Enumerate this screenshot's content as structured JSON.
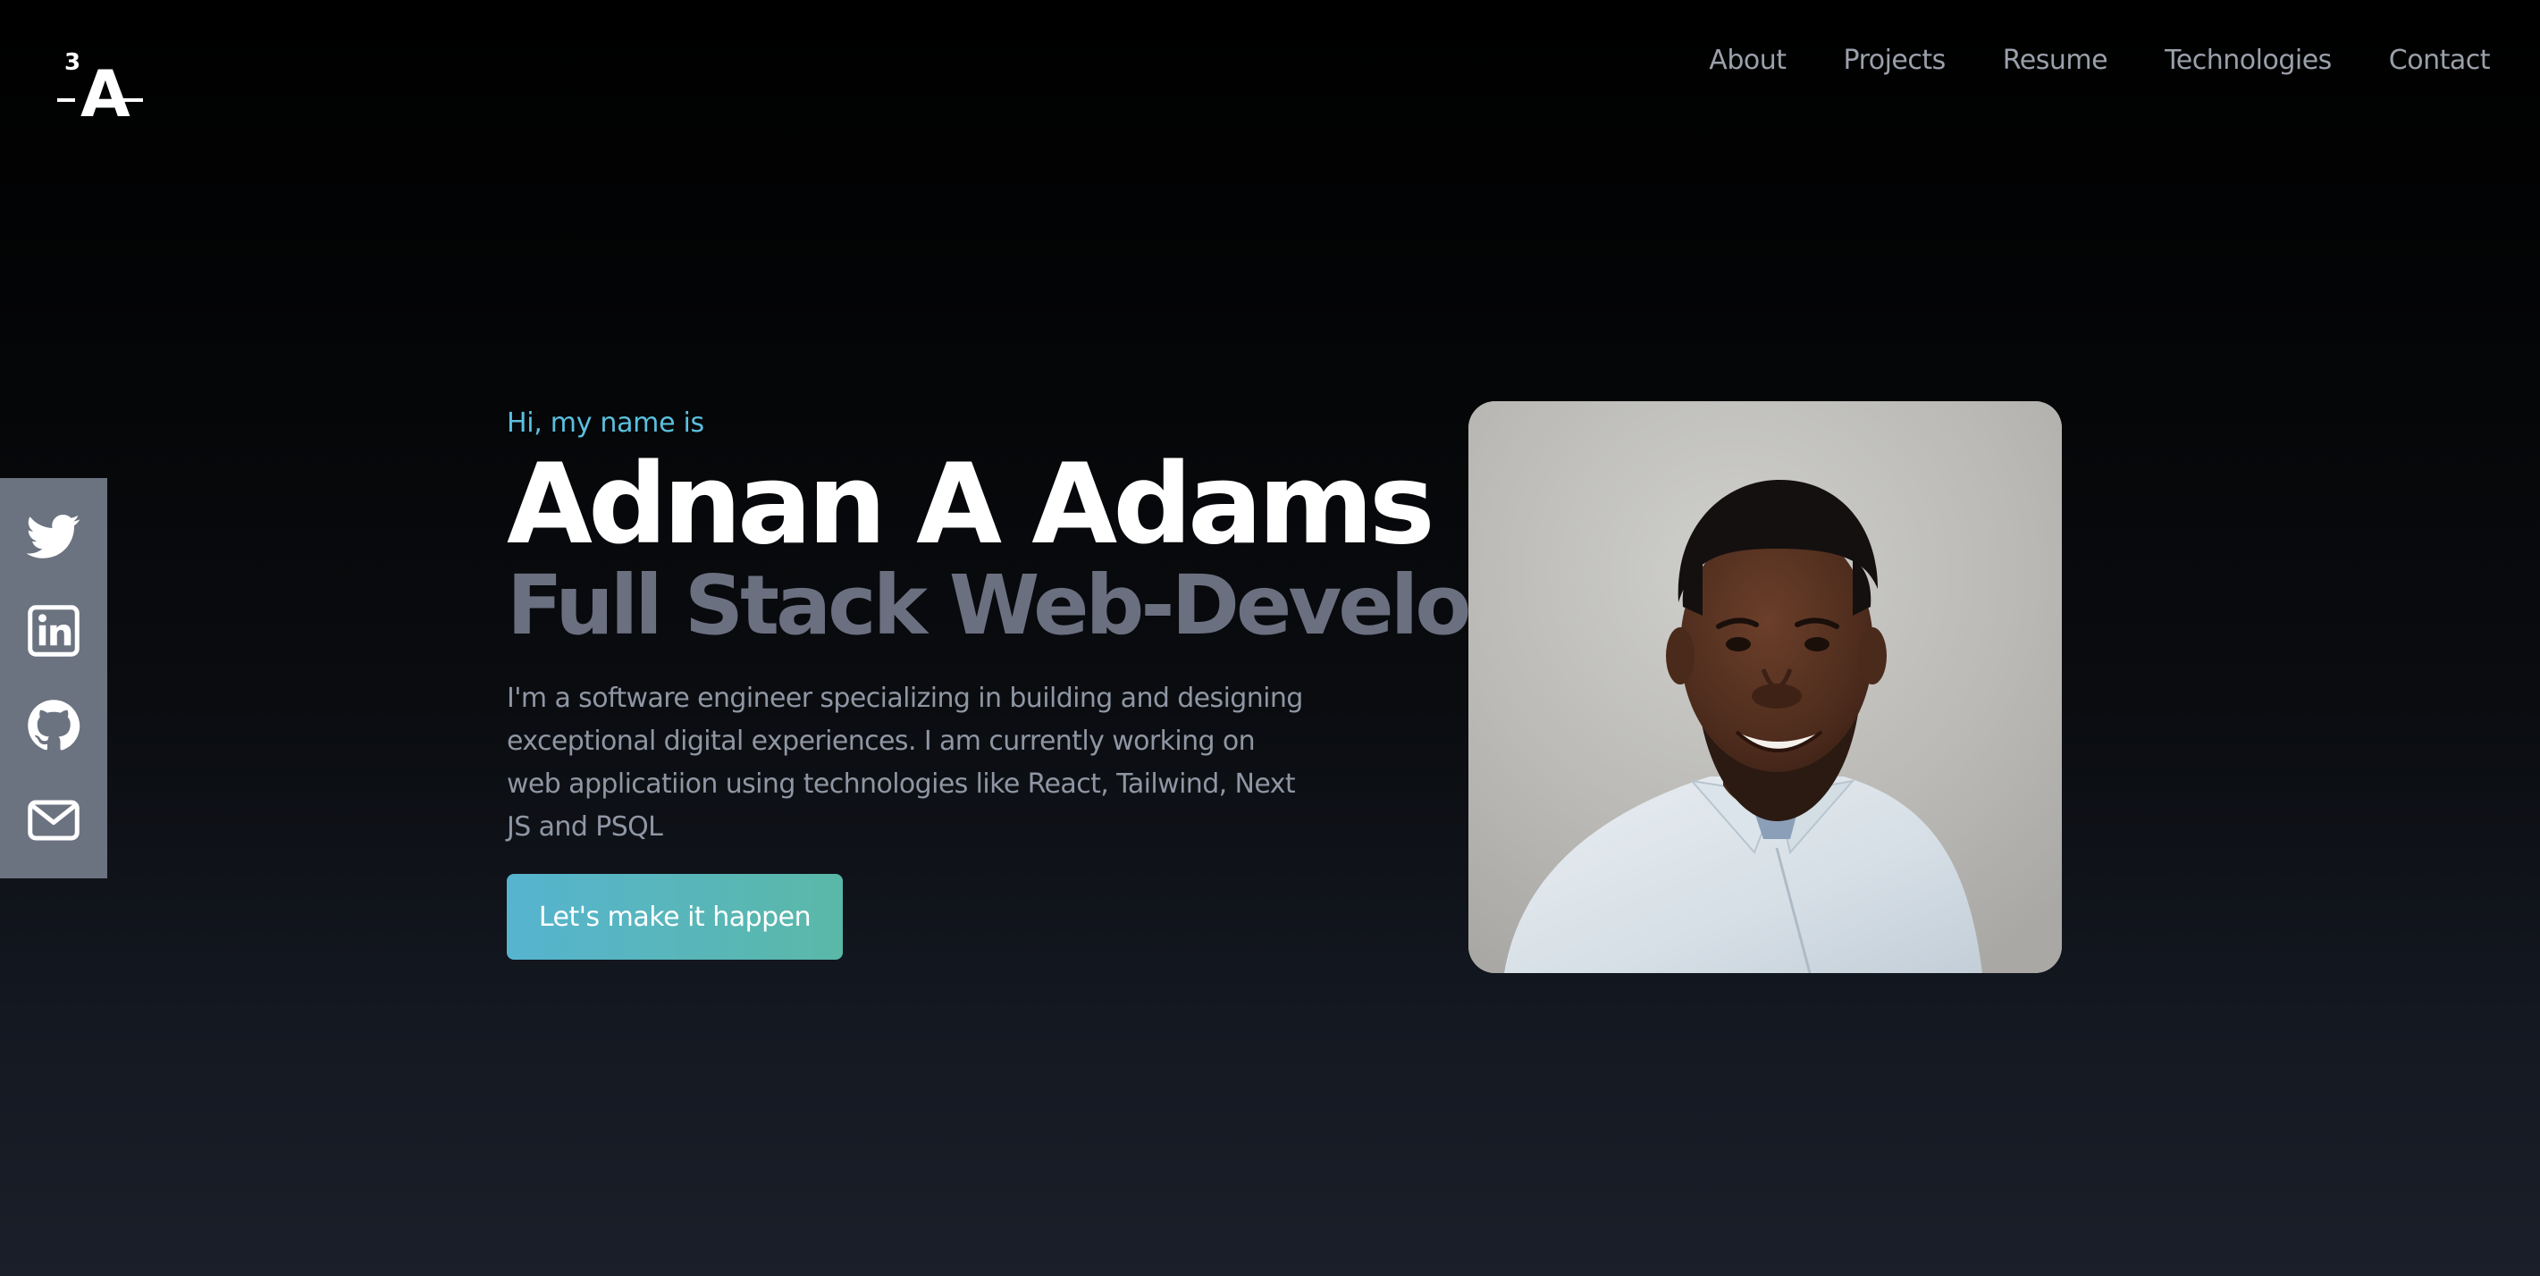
{
  "header": {
    "logo": {
      "superscript": "3",
      "letter": "A",
      "icon": "logo-icon"
    },
    "nav": [
      {
        "label": "About"
      },
      {
        "label": "Projects"
      },
      {
        "label": "Resume"
      },
      {
        "label": "Technologies"
      },
      {
        "label": "Contact"
      }
    ]
  },
  "social": {
    "items": [
      {
        "icon": "twitter-icon"
      },
      {
        "icon": "linkedin-icon"
      },
      {
        "icon": "github-icon"
      },
      {
        "icon": "mail-icon"
      }
    ]
  },
  "hero": {
    "greeting": "Hi, my name is",
    "name": "Adnan A Adams",
    "role": "Full Stack Web-Developer",
    "bio": "I'm a software engineer specializing in building and designing exceptional digital experiences. I am currently working on web applicatiion using technologies like React, Tailwind, Next JS and PSQL",
    "cta_label": "Let's make it happen"
  },
  "colors": {
    "accent": "#5bc0de",
    "button_start": "#56b4cf",
    "button_end": "#5ab8a8",
    "sidebar": "#6b7280",
    "background_top": "#000000",
    "background_bottom": "#1b1f29"
  }
}
